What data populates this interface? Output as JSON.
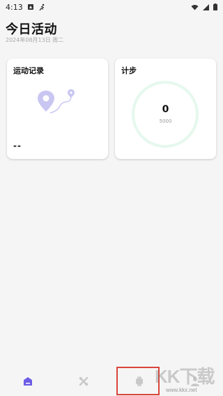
{
  "status_bar": {
    "time": "4:13",
    "icons": [
      "notification-icon",
      "activity-icon",
      "wifi-icon",
      "signal-icon",
      "battery-icon"
    ]
  },
  "header": {
    "title": "今日活动",
    "date": "2024年08月13日 周二"
  },
  "cards": {
    "activity": {
      "title": "运动记录",
      "value": "--",
      "illustration": "location-route-icon"
    },
    "steps": {
      "title": "计步",
      "value": "0",
      "goal": "5000",
      "progress": 0
    }
  },
  "bottom_nav": {
    "items": [
      {
        "name": "home-icon",
        "active": true
      },
      {
        "name": "sport-icon",
        "active": false
      },
      {
        "name": "watch-icon",
        "active": false
      },
      {
        "name": "profile-icon",
        "active": false
      }
    ]
  },
  "watermark": {
    "brand": "KK下载",
    "url": "www.kkx.net"
  },
  "colors": {
    "accent": "#6c5ce7",
    "illustration": "#c9c6f2",
    "ring": "#e6f8ee",
    "highlight": "#d9443a"
  }
}
